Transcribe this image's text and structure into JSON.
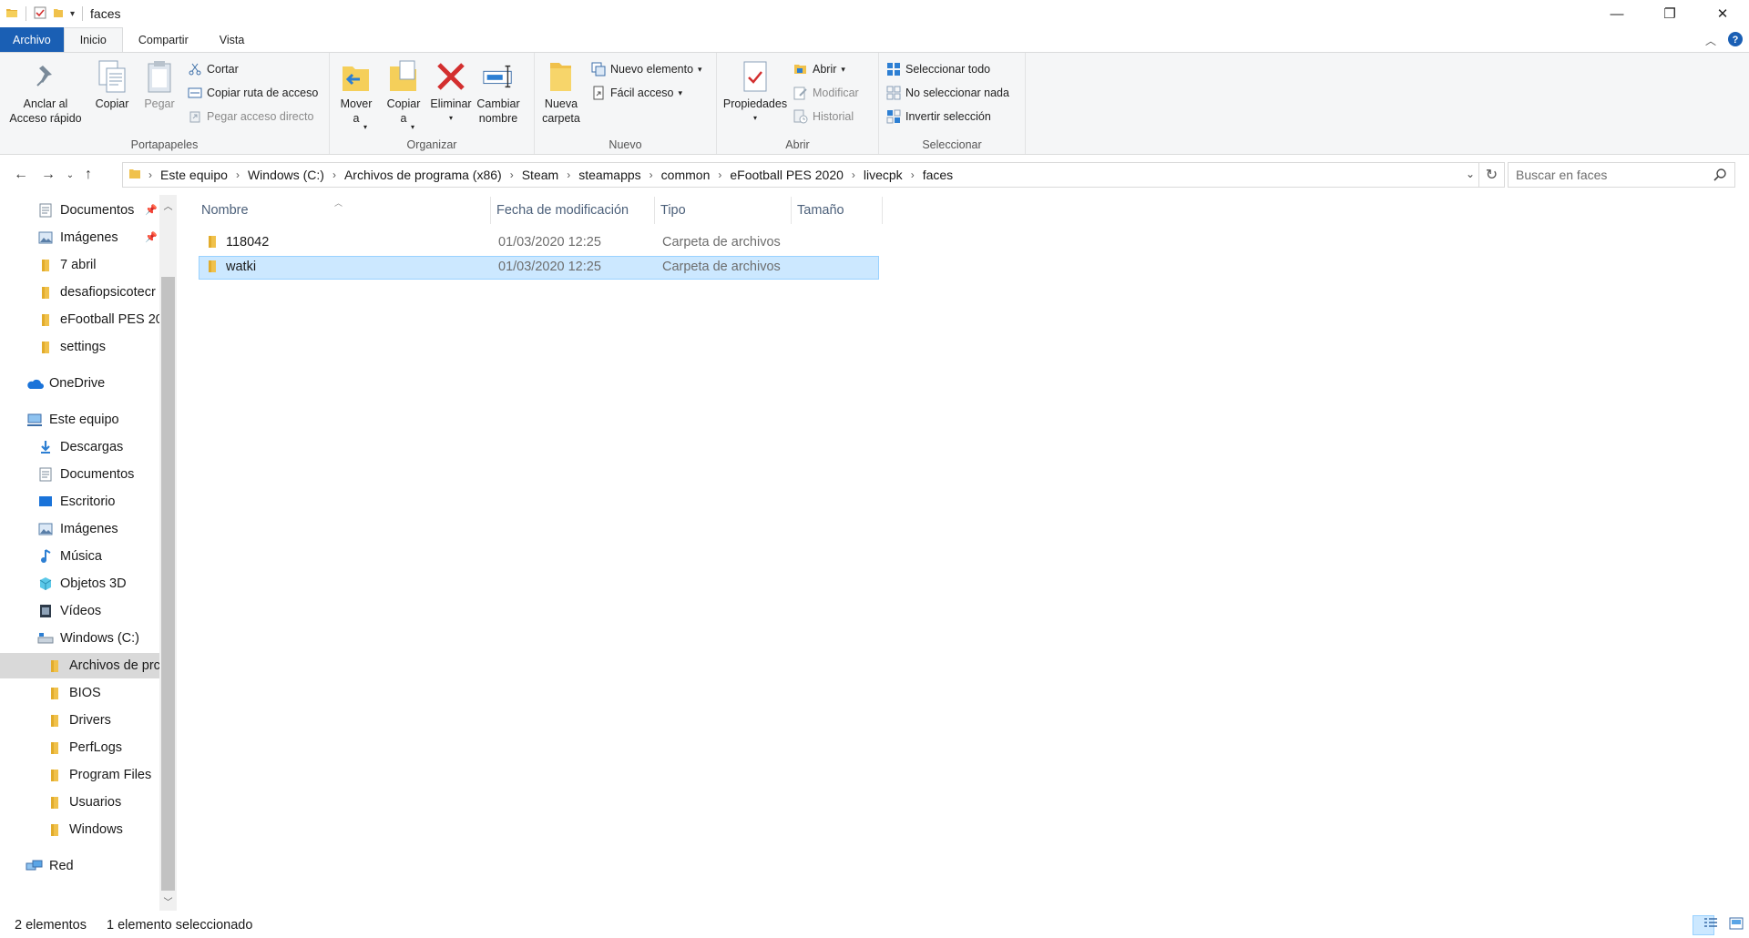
{
  "window": {
    "title": "faces",
    "controls": {
      "minimize": "—",
      "maximize": "❐",
      "close": "✕"
    }
  },
  "ribbon_tabs": [
    {
      "label": "Archivo"
    },
    {
      "label": "Inicio"
    },
    {
      "label": "Compartir"
    },
    {
      "label": "Vista"
    }
  ],
  "ribbon": {
    "portapapeles": {
      "label": "Portapapeles",
      "pin": "Anclar al\nAcceso rápido",
      "copy": "Copiar",
      "paste": "Pegar",
      "cut": "Cortar",
      "copy_path": "Copiar ruta de acceso",
      "paste_shortcut": "Pegar acceso directo"
    },
    "organizar": {
      "label": "Organizar",
      "move": "Mover\na",
      "copy_to": "Copiar\na",
      "delete": "Eliminar",
      "rename": "Cambiar\nnombre"
    },
    "nuevo": {
      "label": "Nuevo",
      "new_folder": "Nueva\ncarpeta",
      "new_item": "Nuevo elemento",
      "easy_access": "Fácil acceso"
    },
    "abrir": {
      "label": "Abrir",
      "properties": "Propiedades",
      "open": "Abrir",
      "edit": "Modificar",
      "history": "Historial"
    },
    "seleccionar": {
      "label": "Seleccionar",
      "select_all": "Seleccionar todo",
      "select_none": "No seleccionar nada",
      "invert": "Invertir selección"
    }
  },
  "address": {
    "crumbs": [
      "Este equipo",
      "Windows (C:)",
      "Archivos de programa (x86)",
      "Steam",
      "steamapps",
      "common",
      "eFootball PES 2020",
      "livecpk",
      "faces"
    ],
    "search_placeholder": "Buscar en faces"
  },
  "nav": {
    "quick": [
      {
        "label": "Documentos",
        "icon": "documents-icon",
        "pinned": true
      },
      {
        "label": "Imágenes",
        "icon": "pictures-icon",
        "pinned": true
      },
      {
        "label": "7 abril",
        "icon": "folder-icon"
      },
      {
        "label": "desafiopsicotecr",
        "icon": "folder-icon"
      },
      {
        "label": "eFootball PES 20",
        "icon": "folder-icon"
      },
      {
        "label": "settings",
        "icon": "folder-icon"
      }
    ],
    "onedrive": "OneDrive",
    "this_pc": "Este equipo",
    "pc_items": [
      {
        "label": "Descargas",
        "icon": "downloads-icon"
      },
      {
        "label": "Documentos",
        "icon": "documents-icon"
      },
      {
        "label": "Escritorio",
        "icon": "desktop-icon"
      },
      {
        "label": "Imágenes",
        "icon": "pictures-icon"
      },
      {
        "label": "Música",
        "icon": "music-icon"
      },
      {
        "label": "Objetos 3D",
        "icon": "3d-objects-icon"
      },
      {
        "label": "Vídeos",
        "icon": "videos-icon"
      },
      {
        "label": "Windows (C:)",
        "icon": "drive-icon"
      }
    ],
    "drive_items": [
      {
        "label": "Archivos de prc",
        "selected": true
      },
      {
        "label": "BIOS"
      },
      {
        "label": "Drivers"
      },
      {
        "label": "PerfLogs"
      },
      {
        "label": "Program Files"
      },
      {
        "label": "Usuarios"
      },
      {
        "label": "Windows"
      }
    ],
    "network": "Red"
  },
  "columns": {
    "name": "Nombre",
    "modified": "Fecha de modificación",
    "type": "Tipo",
    "size": "Tamaño"
  },
  "files": [
    {
      "name": "118042",
      "modified": "01/03/2020 12:25",
      "type": "Carpeta de archivos",
      "size": "",
      "selected": false
    },
    {
      "name": "watki",
      "modified": "01/03/2020 12:25",
      "type": "Carpeta de archivos",
      "size": "",
      "selected": true
    }
  ],
  "status": {
    "count": "2 elementos",
    "selection": "1 elemento seleccionado"
  },
  "colors": {
    "accent": "#1a5fb4",
    "folder": "#f0c14b",
    "selection": "#cce8ff",
    "delete_red": "#d32f2f"
  }
}
